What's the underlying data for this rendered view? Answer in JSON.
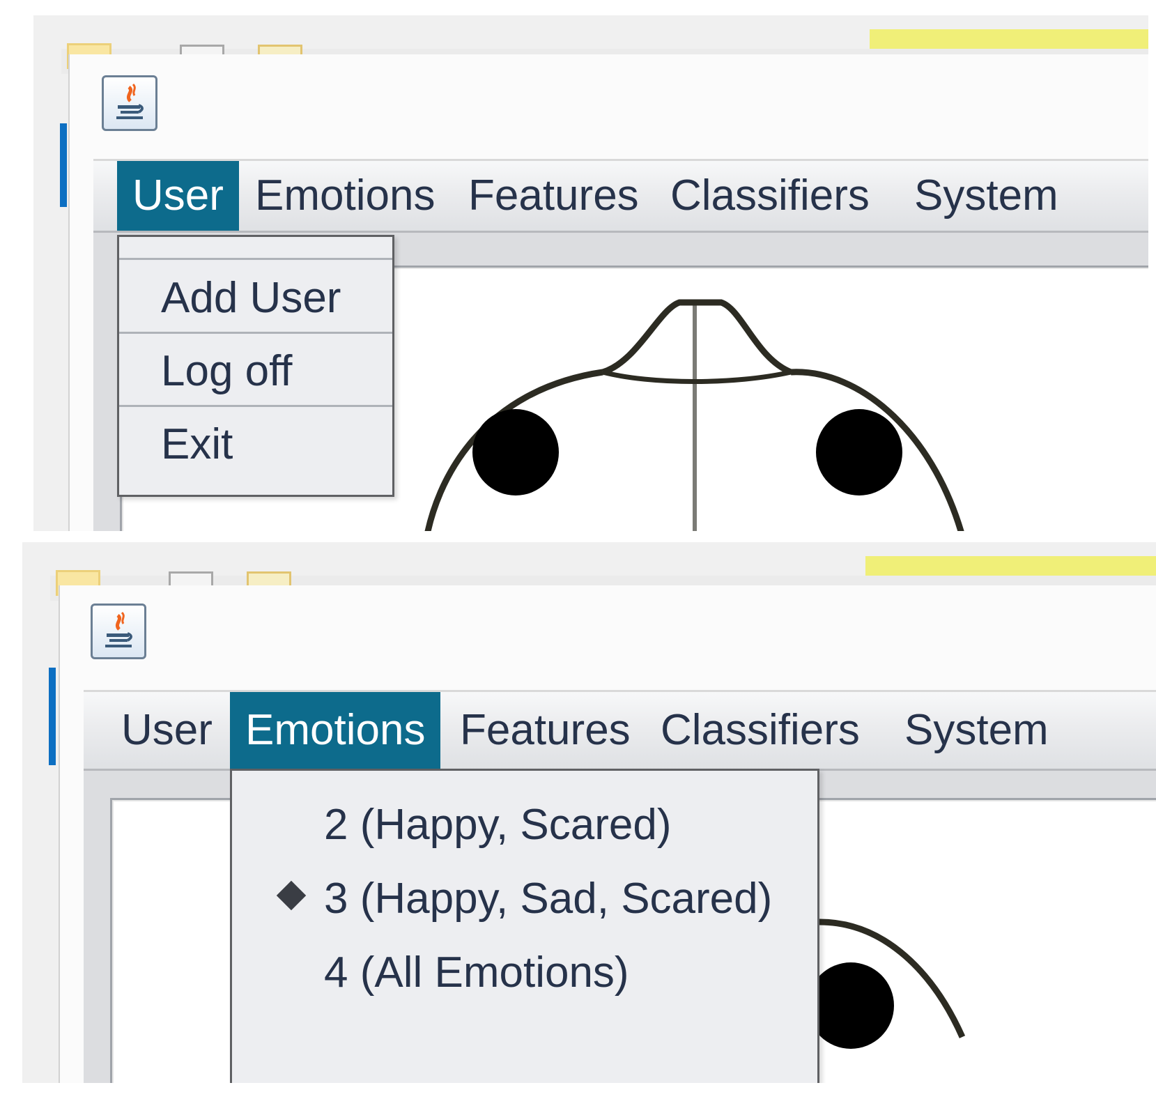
{
  "screens": [
    {
      "menubar": {
        "items": [
          {
            "label": "User",
            "active": true
          },
          {
            "label": "Emotions",
            "active": false
          },
          {
            "label": "Features",
            "active": false
          },
          {
            "label": "Classifiers",
            "active": false
          },
          {
            "label": "System",
            "active": false
          }
        ]
      },
      "dropdown": {
        "menu": "User",
        "items": [
          {
            "label": "Add User"
          },
          {
            "label": "Log off"
          },
          {
            "label": "Exit"
          }
        ]
      }
    },
    {
      "menubar": {
        "items": [
          {
            "label": "User",
            "active": false
          },
          {
            "label": "Emotions",
            "active": true
          },
          {
            "label": "Features",
            "active": false
          },
          {
            "label": "Classifiers",
            "active": false
          },
          {
            "label": "System",
            "active": false
          }
        ]
      },
      "dropdown": {
        "menu": "Emotions",
        "items": [
          {
            "label": "2 (Happy, Scared)",
            "selected": false
          },
          {
            "label": "3 (Happy, Sad, Scared)",
            "selected": true
          },
          {
            "label": "4 (All Emotions)",
            "selected": false
          }
        ]
      }
    }
  ],
  "colors": {
    "menu_active_bg": "#0d6b8c",
    "menu_text": "#26324a",
    "dropdown_bg": "#edeef1",
    "accent_yellow": "#f0ef78",
    "face_stroke": "#2c2b22"
  },
  "icons": [
    "java-app-icon",
    "radio-selected-icon"
  ]
}
